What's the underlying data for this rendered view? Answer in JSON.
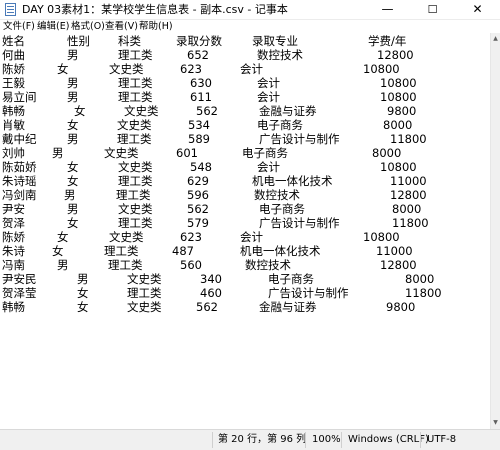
{
  "window": {
    "title": "DAY 03素材1：某学校学生信息表 - 副本.csv - 记事本",
    "minimize": "—",
    "maximize": "☐",
    "close": "✕"
  },
  "menu": [
    "文件(F)",
    "编辑(E)",
    "格式(O)",
    "查看(V)",
    "帮助(H)"
  ],
  "rows": [
    [
      "姓名",
      "性别",
      "科类",
      "录取分数",
      "录取专业",
      "学费/年"
    ],
    [
      "何曲",
      "男",
      "理工类",
      "652",
      "数控技术",
      "12800"
    ],
    [
      "陈娇",
      "女",
      "文史类",
      "623",
      "会计",
      "10800"
    ],
    [
      "王毅",
      "男",
      "理工类",
      "630",
      "会计",
      "10800"
    ],
    [
      "易立间",
      "男",
      "理工类",
      "611",
      "会计",
      "10800"
    ],
    [
      "韩畅",
      "女",
      "文史类",
      "562",
      "金融与证券",
      "9800"
    ],
    [
      "肖敏",
      "女",
      "文史类",
      "534",
      "电子商务",
      "8000"
    ],
    [
      "戴中纪",
      "男",
      "理工类",
      "589",
      "广告设计与制作",
      "11800"
    ],
    [
      "刘帅",
      "男",
      "文史类",
      "601",
      "电子商务",
      "8000"
    ],
    [
      "陈茹娇",
      "女",
      "文史类",
      "548",
      "会计",
      "10800"
    ],
    [
      "朱诗瑶",
      "女",
      "理工类",
      "629",
      "机电一体化技术",
      "11000"
    ],
    [
      "冯剑南",
      "男",
      "理工类",
      "596",
      "数控技术",
      "12800"
    ],
    [
      "尹安",
      "男",
      "文史类",
      "562",
      "电子商务",
      "8000"
    ],
    [
      "贺泽",
      "女",
      "理工类",
      "579",
      "广告设计与制作",
      "11800"
    ],
    [
      "陈娇",
      "女",
      "文史类",
      "623",
      "会计",
      "10800"
    ],
    [
      "朱诗",
      "女",
      "理工类",
      "487",
      "机电一体化技术",
      "11000"
    ],
    [
      "冯南",
      "男",
      "理工类",
      "560",
      "数控技术",
      "12800"
    ],
    [
      "尹安民",
      "男",
      "文史类",
      "340",
      "电子商务",
      "8000"
    ],
    [
      "贺泽莹",
      "女",
      "理工类",
      "460",
      "广告设计与制作",
      "11800"
    ],
    [
      "韩畅",
      "女",
      "文史类",
      "562",
      "金融与证券",
      "9800"
    ]
  ],
  "status": {
    "position": "第 20 行，第 96 列",
    "zoom": "100%",
    "line_ending": "Windows (CRLF)",
    "encoding": "UTF-8"
  }
}
